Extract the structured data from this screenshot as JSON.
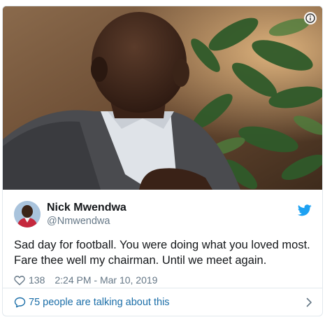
{
  "tweet": {
    "author": {
      "display_name": "Nick Mwendwa",
      "handle": "@Nmwendwa",
      "avatar_icon": "profile-photo"
    },
    "text": "Sad day for football. You were doing what you loved most. Fare thee well my chairman. Until we meet again.",
    "likes": "138",
    "timestamp": "2:24 PM - Mar 10, 2019",
    "talking_link": "75 people are talking about this",
    "icons": {
      "info": "info-icon",
      "brand": "twitter-bird-icon",
      "like": "heart-icon",
      "reply": "speech-bubble-icon",
      "more": "chevron-right-icon"
    }
  },
  "colors": {
    "accent_blue": "#1da1f2",
    "link_blue": "#1b6ea8",
    "muted_gray": "#657786",
    "border": "#e1e8ed"
  }
}
